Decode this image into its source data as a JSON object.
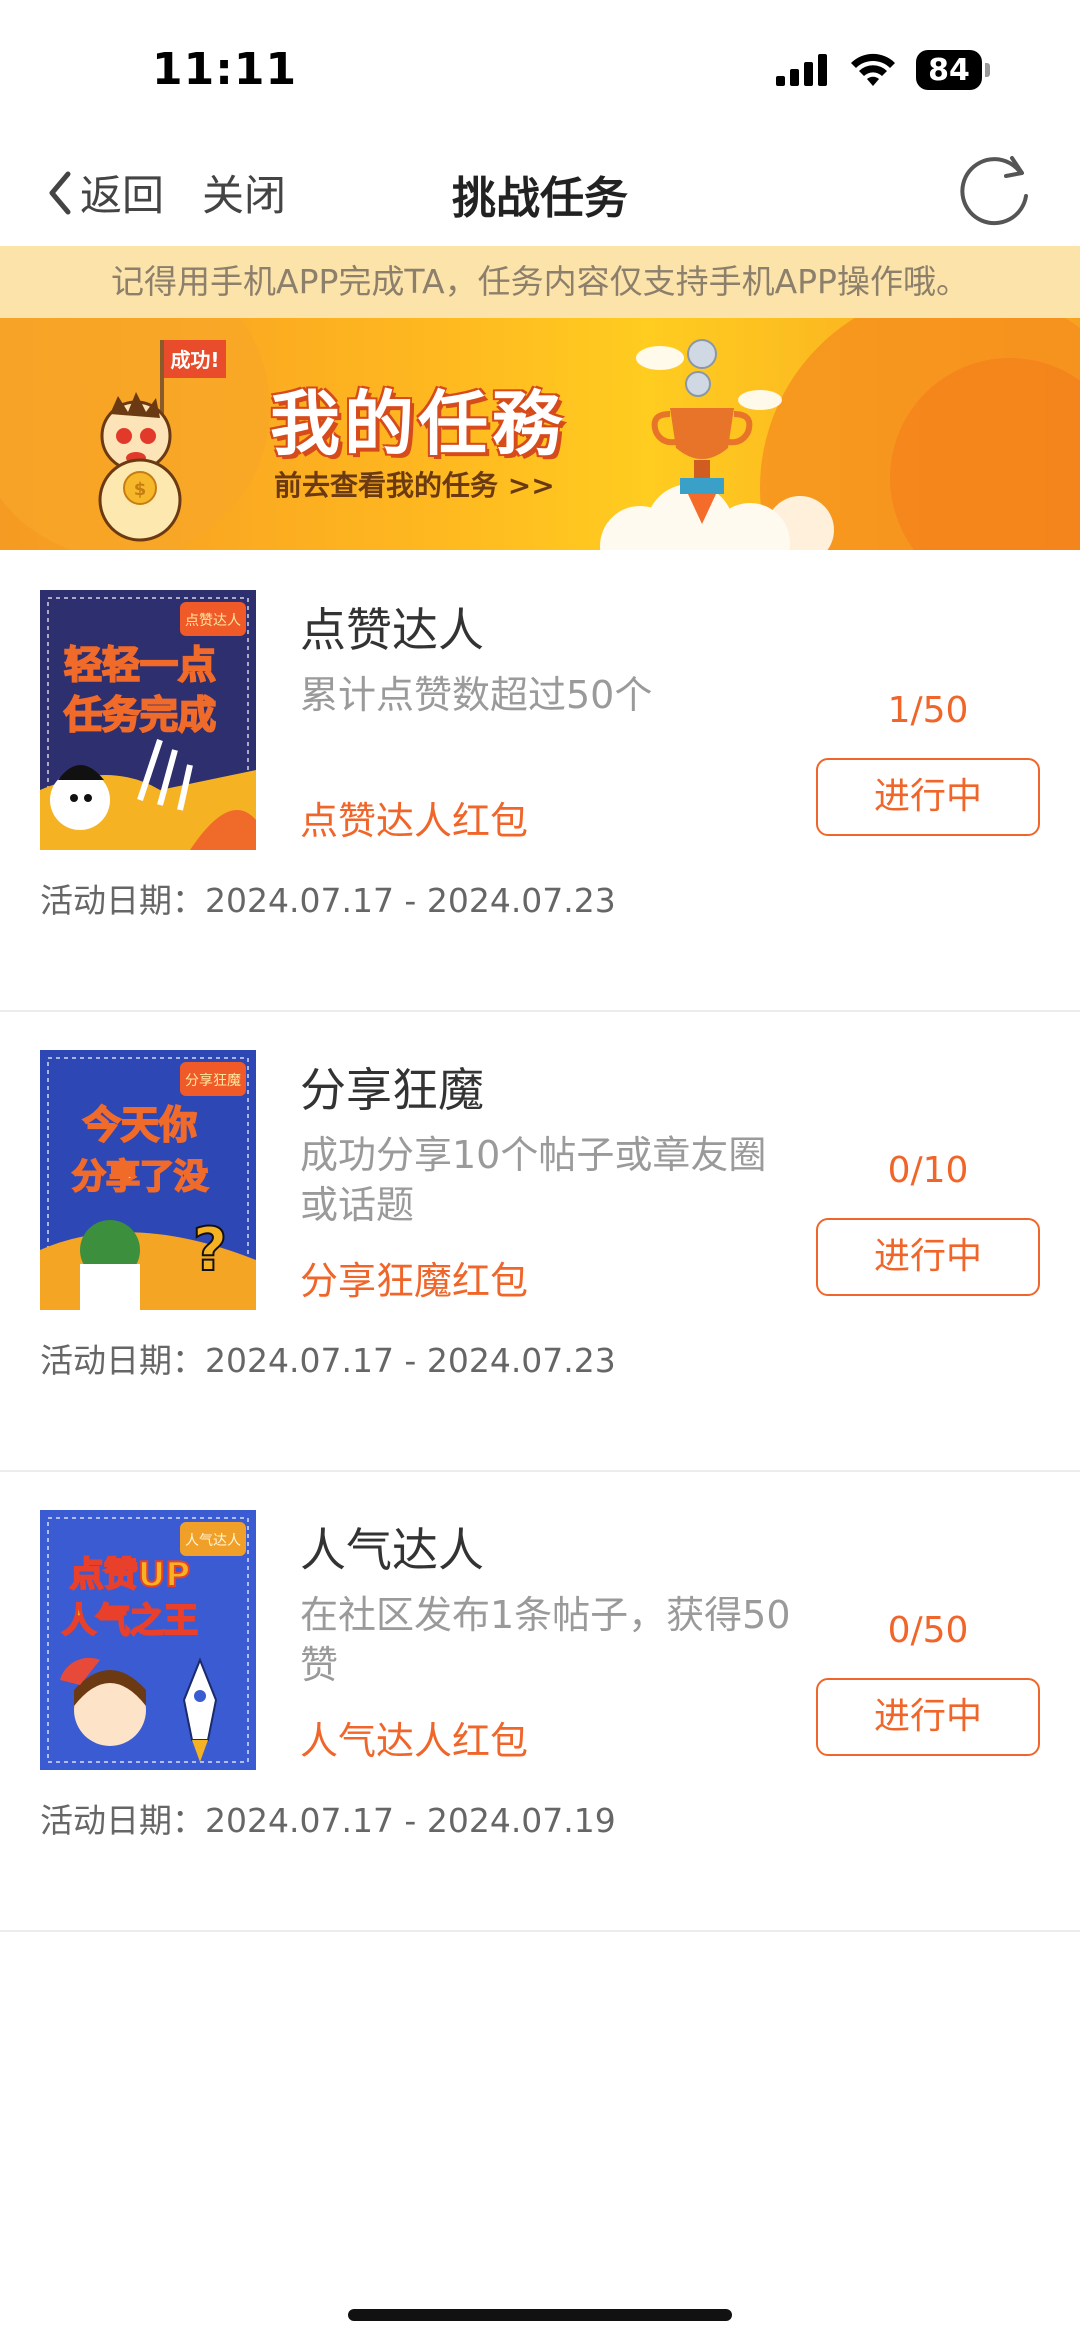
{
  "status_bar": {
    "time": "11:11",
    "battery": "84"
  },
  "nav": {
    "back_label": "返回",
    "close_label": "关闭",
    "title": "挑战任务"
  },
  "notice": "记得用手机APP完成TA，任务内容仅支持手机APP操作哦。",
  "banner": {
    "title": "我的任務",
    "link": "前去查看我的任务 >>",
    "badge": "成功!"
  },
  "date_prefix": "活动日期：",
  "tasks": [
    {
      "name": "点赞达人",
      "description": "累计点赞数超过50个",
      "reward": "点赞达人红包",
      "progress": "1/50",
      "status": "进行中",
      "date": "2024.07.17 - 2024.07.23",
      "thumb_text": [
        "轻轻一点",
        "任务完成"
      ],
      "thumb_badge": "点赞达人"
    },
    {
      "name": "分享狂魔",
      "description": "成功分享10个帖子或章友圈或话题",
      "reward": "分享狂魔红包",
      "progress": "0/10",
      "status": "进行中",
      "date": "2024.07.17 - 2024.07.23",
      "thumb_text": [
        "今天你",
        "分享了没"
      ],
      "thumb_badge": "分享狂魔"
    },
    {
      "name": "人气达人",
      "description": "在社区发布1条帖子，获得50赞",
      "reward": "人气达人红包",
      "progress": "0/50",
      "status": "进行中",
      "date": "2024.07.17 - 2024.07.19",
      "thumb_text": [
        "点赞UP",
        "人气之王"
      ],
      "thumb_badge": "人气达人"
    }
  ],
  "colors": {
    "accent": "#f0662a",
    "notice_bg": "#fbe3a9",
    "banner_orange": "#f7a21f"
  }
}
